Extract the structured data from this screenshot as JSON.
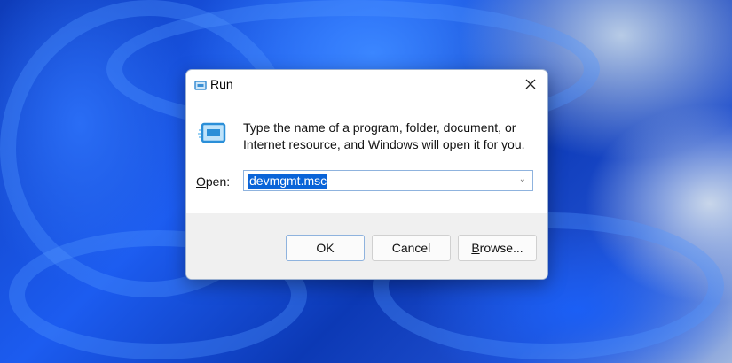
{
  "dialog": {
    "title": "Run",
    "description_line1": "Type the name of a program, folder, document, or",
    "description_line2": "Internet resource, and Windows will open it for you.",
    "open_label": "Open:",
    "open_value": "devmgmt.msc",
    "buttons": {
      "ok": "OK",
      "cancel": "Cancel",
      "browse": "Browse..."
    }
  },
  "colors": {
    "selection": "#0a64d8",
    "footer": "#f0f0f0",
    "accent_border": "#8fb3de"
  }
}
